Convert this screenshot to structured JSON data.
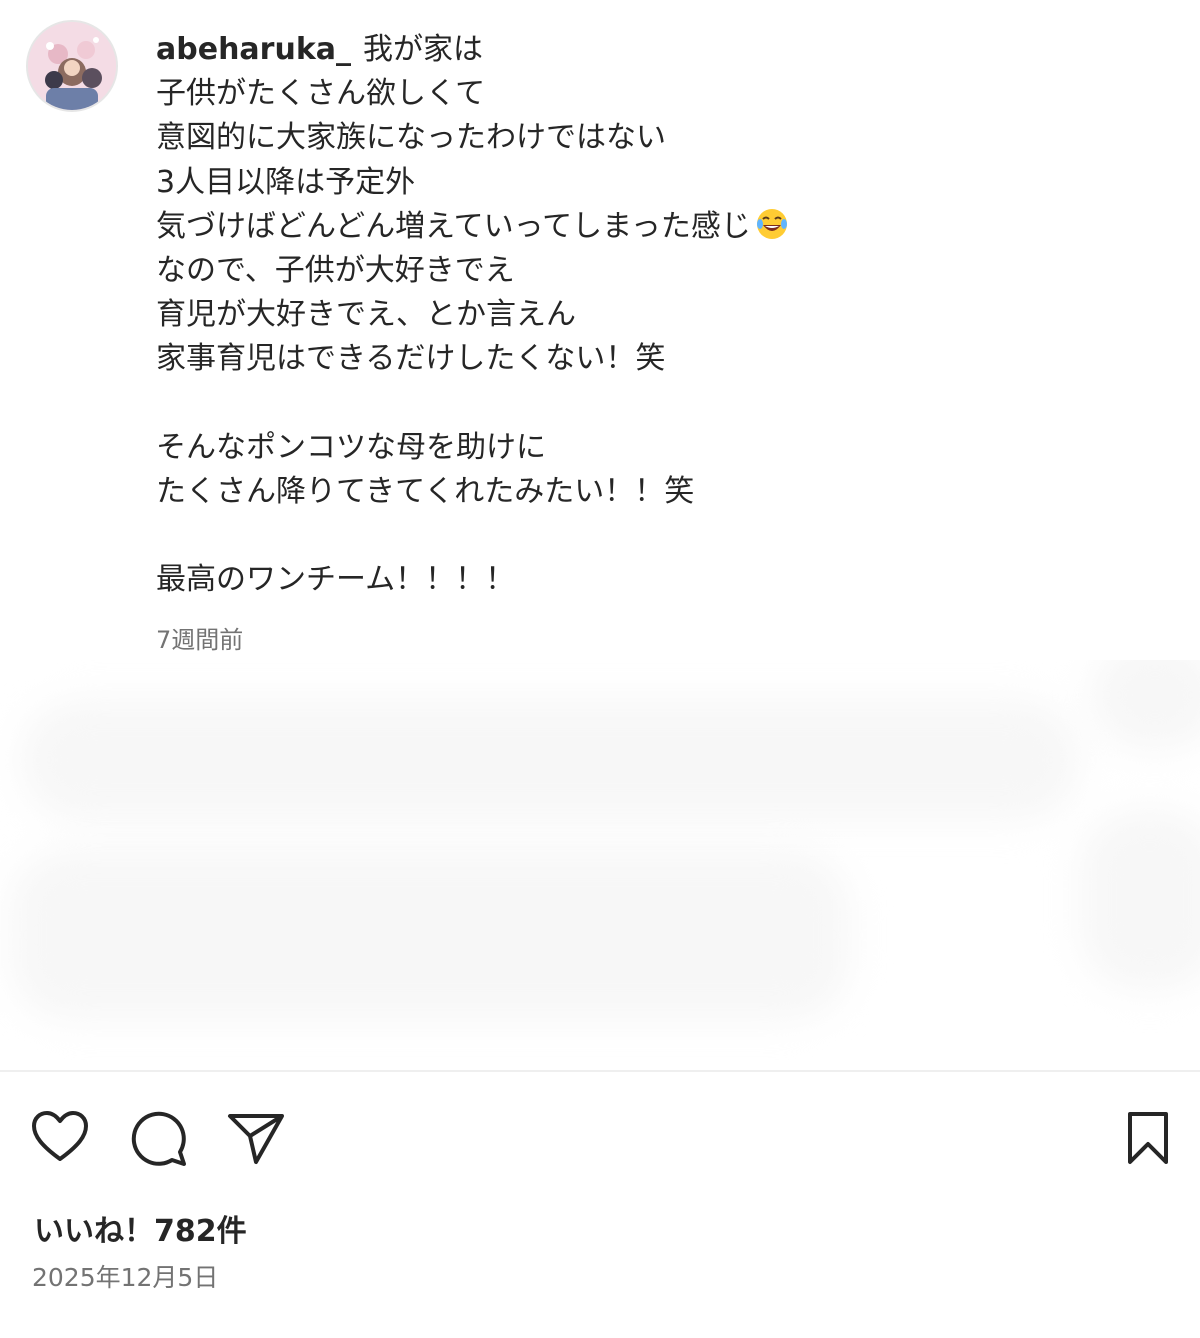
{
  "post": {
    "username": "abeharuka_",
    "caption_lines": [
      "我が家は",
      "子供がたくさん欲しくて",
      "意図的に大家族になったわけではない",
      "3人目以降は予定外",
      "気づけばどんどん増えていってしまった感じ",
      "なので、子供が大好きでえ",
      "育児が大好きでえ、とか言えん",
      "家事育児はできるだけしたくない！笑",
      "",
      "そんなポンコツな母を助けに",
      "たくさん降りてきてくれたみたい！！笑",
      "",
      "最高のワンチーム！！！！"
    ],
    "emoji_icon": "laughing-tears-emoji",
    "relative_time": "7週間前",
    "likes_text": "いいね！782件",
    "date": "2025年12月5日"
  },
  "actions": {
    "like_icon": "heart-icon",
    "comment_icon": "comment-icon",
    "share_icon": "paper-plane-icon",
    "save_icon": "bookmark-icon"
  },
  "colors": {
    "text": "#262626",
    "secondary_text": "#737373",
    "divider": "#efefef"
  }
}
